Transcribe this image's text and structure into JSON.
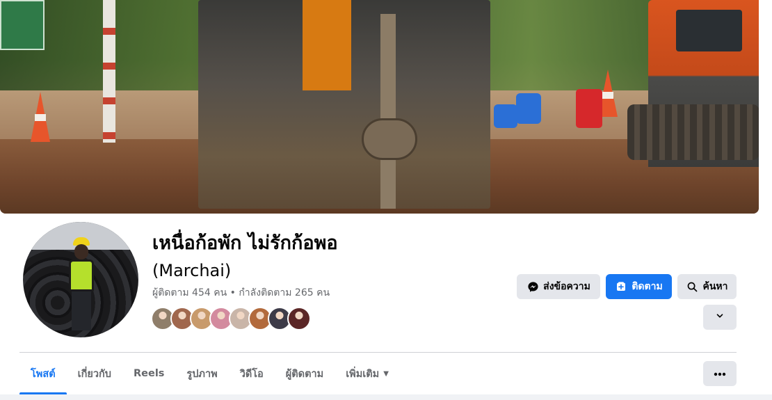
{
  "profile": {
    "name": "เหนื่อก้อพัก ไม่รักก้อพอ",
    "alternate_name": "(Marchai)",
    "followers_label": "ผู้ติดตาม",
    "followers_count": "454",
    "followers_unit": "คน",
    "separator": "•",
    "following_label": "กำลังติดตาม",
    "following_count": "265",
    "following_unit": "คน",
    "follower_avatar_colors": [
      "#8f7e6a",
      "#a0674d",
      "#c89a6b",
      "#d38a9e",
      "#c9b5a8",
      "#b26a3c",
      "#3d3b48",
      "#5b2626"
    ]
  },
  "actions": {
    "message_label": "ส่งข้อความ",
    "message_icon": "messenger-icon",
    "follow_label": "ติดตาม",
    "follow_icon": "follow-plus-icon",
    "search_label": "ค้นหา",
    "search_icon": "search-icon",
    "more_icon": "chevron-down-icon"
  },
  "tabs": [
    {
      "label": "โพสต์",
      "active": true
    },
    {
      "label": "เกี่ยวกับ",
      "active": false
    },
    {
      "label": "Reels",
      "active": false
    },
    {
      "label": "รูปภาพ",
      "active": false
    },
    {
      "label": "วิดีโอ",
      "active": false
    },
    {
      "label": "ผู้ติดตาม",
      "active": false
    },
    {
      "label": "เพิ่มเติม",
      "active": false
    }
  ],
  "tab_more_icon": "ellipsis-icon",
  "colors": {
    "accent": "#1877f2",
    "button_gray": "#e4e6eb",
    "secondary_text": "#65676b"
  }
}
